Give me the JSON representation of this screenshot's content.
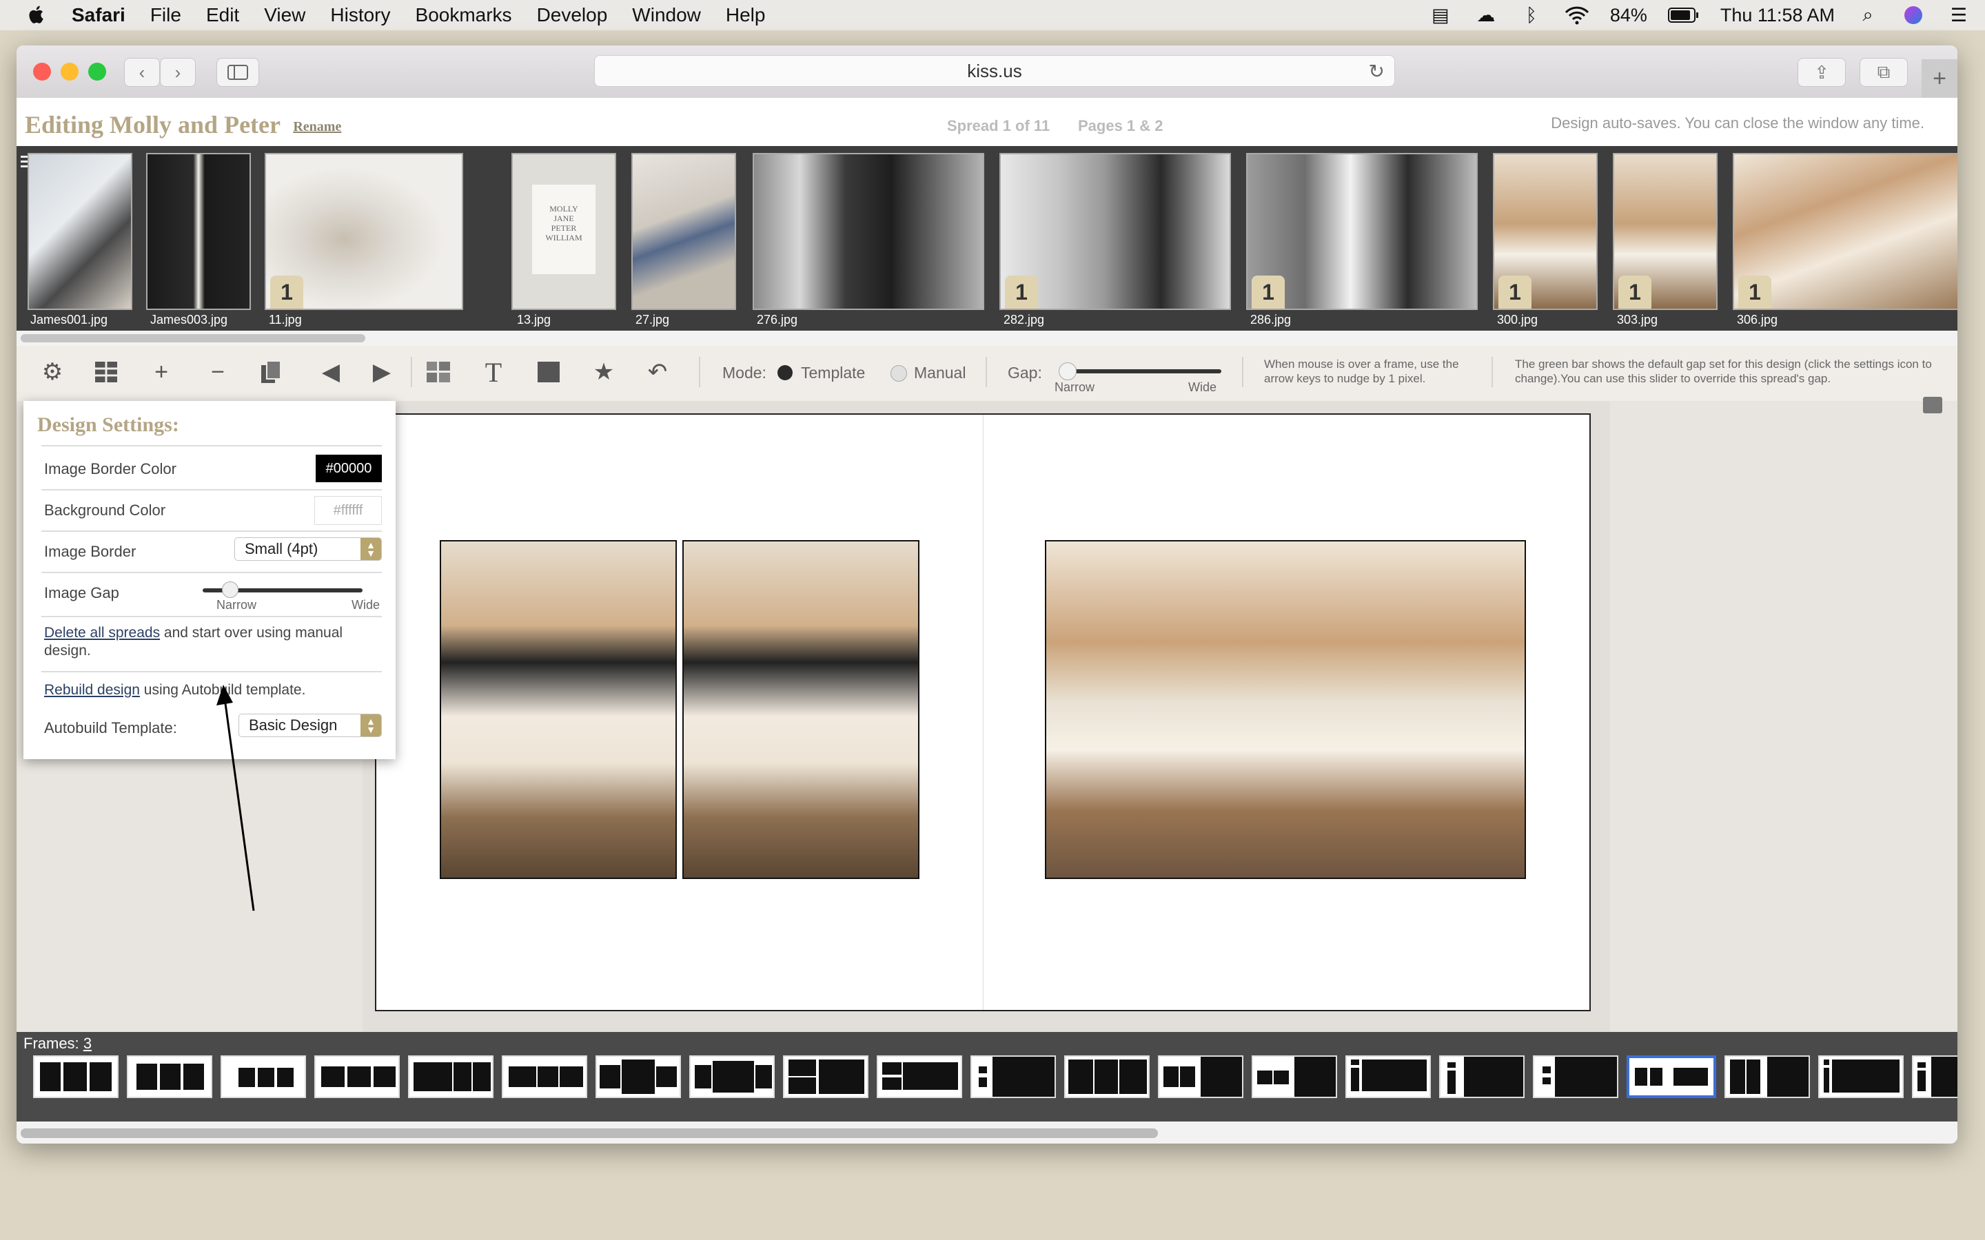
{
  "menubar": {
    "app": "Safari",
    "items": [
      "File",
      "Edit",
      "View",
      "History",
      "Bookmarks",
      "Develop",
      "Window",
      "Help"
    ],
    "battery": "84%",
    "clock": "Thu 11:58 AM"
  },
  "browser": {
    "url": "kiss.us"
  },
  "header": {
    "title": "Editing Molly and Peter",
    "rename": "Rename",
    "spread": "Spread 1 of 11",
    "pages": "Pages 1 & 2",
    "autosave": "Design auto-saves. You can close the window any time."
  },
  "photos": [
    {
      "name": "James001.jpg",
      "badge": ""
    },
    {
      "name": "James003.jpg",
      "badge": ""
    },
    {
      "name": "11.jpg",
      "badge": "1"
    },
    {
      "name": "13.jpg",
      "badge": ""
    },
    {
      "name": "27.jpg",
      "badge": ""
    },
    {
      "name": "276.jpg",
      "badge": ""
    },
    {
      "name": "282.jpg",
      "badge": "1"
    },
    {
      "name": "286.jpg",
      "badge": "1"
    },
    {
      "name": "300.jpg",
      "badge": "1"
    },
    {
      "name": "303.jpg",
      "badge": "1"
    },
    {
      "name": "306.jpg",
      "badge": "1"
    }
  ],
  "invitation_text": [
    "MOLLY",
    "JANE",
    "PETER",
    "WILLIAM"
  ],
  "toolbar": {
    "mode_label": "Mode:",
    "mode_template": "Template",
    "mode_manual": "Manual",
    "gap_label": "Gap:",
    "gap_narrow": "Narrow",
    "gap_wide": "Wide",
    "nudge_hint": "When mouse is over a frame, use the arrow keys to nudge by 1 pixel.",
    "green_bar_hint": "The green bar shows the default gap set for this design (click the settings icon to change).You can use this slider to override this spread's gap.",
    "selected_mode": "Template"
  },
  "settings": {
    "title": "Design Settings:",
    "border_color_label": "Image Border Color",
    "border_color_value": "#00000",
    "bg_color_label": "Background Color",
    "bg_color_value": "#ffffff",
    "border_label": "Image Border",
    "border_value": "Small (4pt)",
    "gap_label": "Image Gap",
    "gap_narrow": "Narrow",
    "gap_wide": "Wide",
    "delete_link": "Delete all spreads",
    "delete_rest": " and start over using manual design.",
    "rebuild_link": "Rebuild design",
    "rebuild_rest": " using Autobuild template.",
    "template_label": "Autobuild Template:",
    "template_value": "Basic Design"
  },
  "frames": {
    "label": "Frames:",
    "count": "3"
  },
  "colors": {
    "accent_tan": "#b4a584",
    "select_tan": "#b9a66f",
    "selected_frame": "#3a6fd8",
    "strip_bg": "#3d3d3d"
  }
}
